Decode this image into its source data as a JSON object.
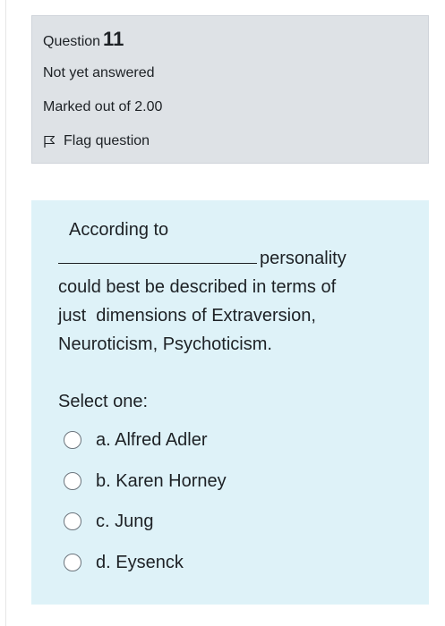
{
  "info": {
    "question_label": "Question",
    "question_number": "11",
    "state": "Not yet answered",
    "grade": "Marked out of 2.00",
    "flag_label": "Flag question"
  },
  "question": {
    "text_line1": "According to",
    "text_after_blank": "personality",
    "text_line3": "could best be described in terms of",
    "text_line4": "just  dimensions of Extraversion,",
    "text_line5": "Neuroticism, Psychoticism.",
    "select_prompt": "Select one:",
    "answers": [
      {
        "label": "a. Alfred Adler",
        "selected": false
      },
      {
        "label": "b. Karen Horney",
        "selected": false
      },
      {
        "label": "c. Jung",
        "selected": false
      },
      {
        "label": "d. Eysenck",
        "selected": false
      }
    ]
  },
  "colors": {
    "info_background": "#dee2e6",
    "content_background": "#def2f8",
    "text": "#1d2125"
  }
}
